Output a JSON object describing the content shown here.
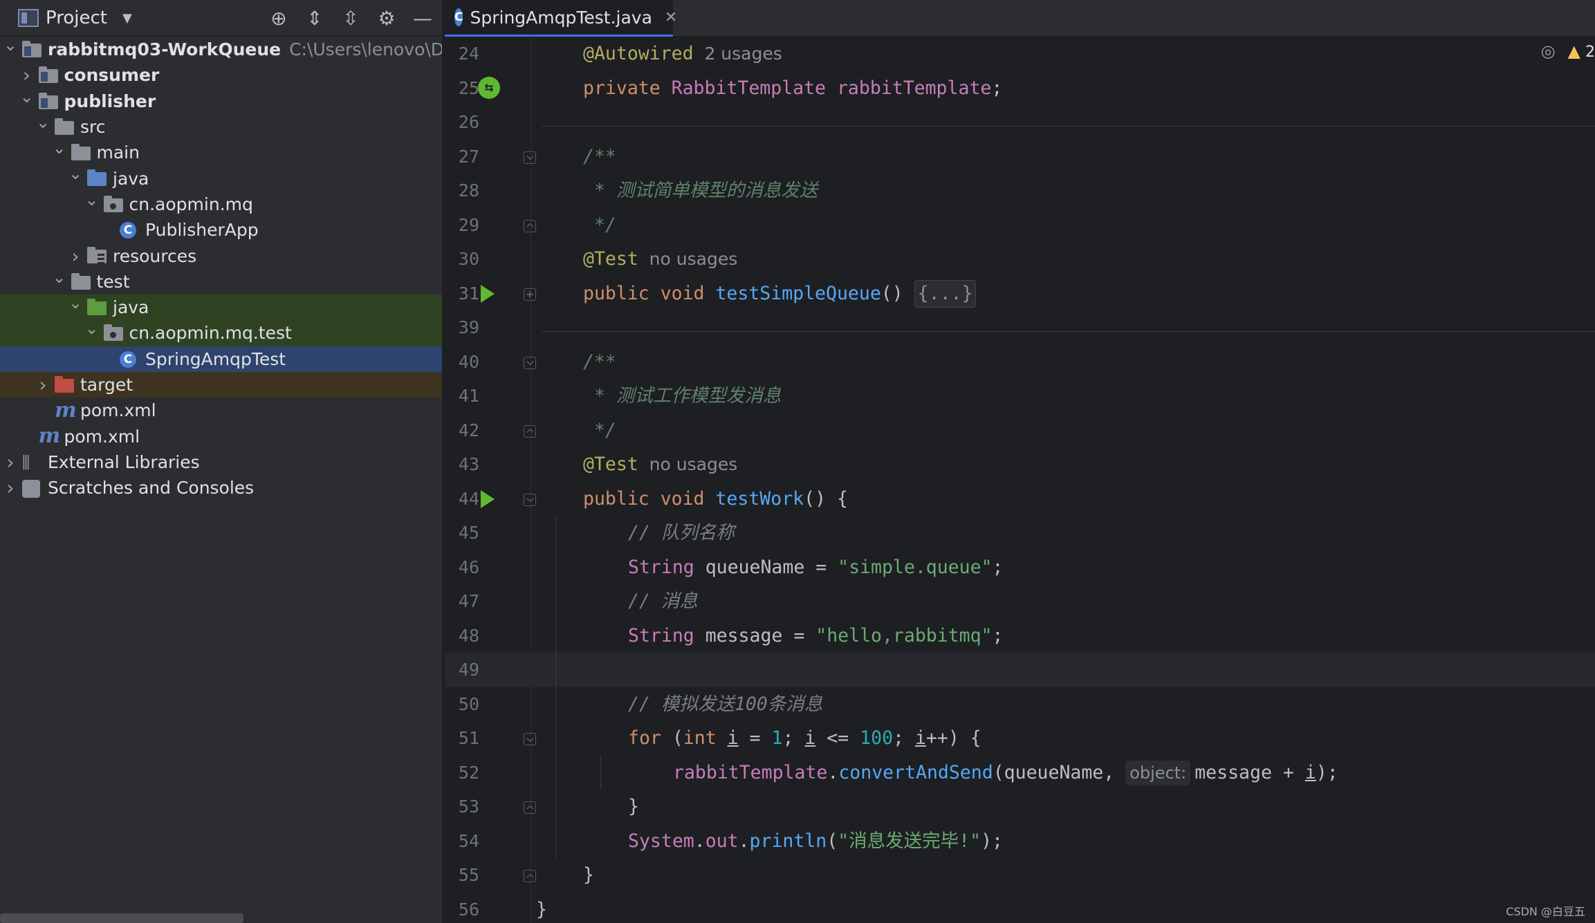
{
  "project_panel": {
    "title": "Project",
    "tools": [
      "locate-icon",
      "expand-all-icon",
      "collapse-all-icon",
      "settings-icon",
      "hide-icon"
    ]
  },
  "tree": [
    {
      "label": "rabbitmq03-WorkQueue",
      "hint": "C:\\Users\\lenovo\\Desk",
      "depth": 0,
      "expanded": true,
      "icon": "module-folder",
      "bold": true
    },
    {
      "label": "consumer",
      "depth": 1,
      "expanded": false,
      "icon": "module-folder",
      "bold": true
    },
    {
      "label": "publisher",
      "depth": 1,
      "expanded": true,
      "icon": "module-folder",
      "bold": true
    },
    {
      "label": "src",
      "depth": 2,
      "expanded": true,
      "icon": "folder"
    },
    {
      "label": "main",
      "depth": 3,
      "expanded": true,
      "icon": "folder"
    },
    {
      "label": "java",
      "depth": 4,
      "expanded": true,
      "icon": "source-folder"
    },
    {
      "label": "cn.aopmin.mq",
      "depth": 5,
      "expanded": true,
      "icon": "package"
    },
    {
      "label": "PublisherApp",
      "depth": 6,
      "icon": "class"
    },
    {
      "label": "resources",
      "depth": 4,
      "expanded": false,
      "icon": "resources-folder"
    },
    {
      "label": "test",
      "depth": 3,
      "expanded": true,
      "icon": "folder"
    },
    {
      "label": "java",
      "depth": 4,
      "expanded": true,
      "icon": "test-folder",
      "highlight": "green"
    },
    {
      "label": "cn.aopmin.mq.test",
      "depth": 5,
      "expanded": true,
      "icon": "package",
      "highlight": "green"
    },
    {
      "label": "SpringAmqpTest",
      "depth": 6,
      "icon": "class",
      "highlight": "selected"
    },
    {
      "label": "target",
      "depth": 2,
      "expanded": false,
      "icon": "excluded-folder",
      "highlight": "excluded"
    },
    {
      "label": "pom.xml",
      "depth": 2,
      "icon": "maven"
    },
    {
      "label": "pom.xml",
      "depth": 1,
      "icon": "maven"
    },
    {
      "label": "External Libraries",
      "depth": 0,
      "expanded": false,
      "icon": "libraries"
    },
    {
      "label": "Scratches and Consoles",
      "depth": 0,
      "expanded": false,
      "icon": "scratches"
    }
  ],
  "editor": {
    "tab": {
      "label": "SpringAmqpTest.java",
      "icon_letter": "C"
    },
    "status": {
      "warnings": "2"
    },
    "lines": [
      {
        "n": "24",
        "indent": 1,
        "tokens": [
          [
            "ann",
            "@Autowired"
          ],
          [
            "hint",
            "  2 usages"
          ]
        ]
      },
      {
        "n": "25",
        "indent": 1,
        "gutter": "bean",
        "tokens": [
          [
            "kw",
            "private "
          ],
          [
            "type",
            "RabbitTemplate "
          ],
          [
            "fieldname",
            "rabbitTemplate"
          ],
          [
            "brk",
            ";"
          ]
        ]
      },
      {
        "n": "26",
        "indent": 0,
        "tokens": []
      },
      {
        "n": "27",
        "indent": 1,
        "fold": "down",
        "tokens": [
          [
            "doc",
            "/**"
          ]
        ]
      },
      {
        "n": "28",
        "indent": 1,
        "tokens": [
          [
            "doc",
            " * 测试简单模型的消息发送"
          ]
        ]
      },
      {
        "n": "29",
        "indent": 1,
        "fold": "up",
        "tokens": [
          [
            "doc",
            " */"
          ]
        ]
      },
      {
        "n": "30",
        "indent": 1,
        "tokens": [
          [
            "ann",
            "@Test"
          ],
          [
            "hint",
            "  no usages"
          ]
        ]
      },
      {
        "n": "31",
        "indent": 1,
        "gutter": "run",
        "fold": "plus",
        "tokens": [
          [
            "kw",
            "public "
          ],
          [
            "kw",
            "void "
          ],
          [
            "fn",
            "testSimpleQueue"
          ],
          [
            "brk",
            "() "
          ],
          [
            "pill",
            "{...}"
          ]
        ]
      },
      {
        "n": "39",
        "indent": 0,
        "tokens": []
      },
      {
        "n": "40",
        "indent": 1,
        "fold": "down",
        "tokens": [
          [
            "doc",
            "/**"
          ]
        ]
      },
      {
        "n": "41",
        "indent": 1,
        "tokens": [
          [
            "doc",
            " * 测试工作模型发消息"
          ]
        ]
      },
      {
        "n": "42",
        "indent": 1,
        "fold": "up",
        "tokens": [
          [
            "doc",
            " */"
          ]
        ]
      },
      {
        "n": "43",
        "indent": 1,
        "tokens": [
          [
            "ann",
            "@Test"
          ],
          [
            "hint",
            "  no usages"
          ]
        ]
      },
      {
        "n": "44",
        "indent": 1,
        "gutter": "run",
        "fold": "down",
        "tokens": [
          [
            "kw",
            "public "
          ],
          [
            "kw",
            "void "
          ],
          [
            "fn",
            "testWork"
          ],
          [
            "brk",
            "() {"
          ]
        ]
      },
      {
        "n": "45",
        "indent": 2,
        "tokens": [
          [
            "cmt",
            "// 队列名称"
          ]
        ]
      },
      {
        "n": "46",
        "indent": 2,
        "tokens": [
          [
            "type",
            "String "
          ],
          [
            "brk",
            "queueName = "
          ],
          [
            "str",
            "\"simple.queue\""
          ],
          [
            "brk",
            ";"
          ]
        ]
      },
      {
        "n": "47",
        "indent": 2,
        "tokens": [
          [
            "cmt",
            "// 消息"
          ]
        ]
      },
      {
        "n": "48",
        "indent": 2,
        "tokens": [
          [
            "type",
            "String "
          ],
          [
            "brk",
            "message = "
          ],
          [
            "str",
            "\"hello,rabbitmq\""
          ],
          [
            "brk",
            ";"
          ]
        ]
      },
      {
        "n": "49",
        "indent": 0,
        "current": true,
        "tokens": []
      },
      {
        "n": "50",
        "indent": 2,
        "tokens": [
          [
            "cmt",
            "// 模拟发送100条消息"
          ]
        ]
      },
      {
        "n": "51",
        "indent": 2,
        "fold": "down",
        "tokens": [
          [
            "kw",
            "for "
          ],
          [
            "brk",
            "("
          ],
          [
            "kw",
            "int "
          ],
          [
            "ulbrk",
            "i"
          ],
          [
            "brk",
            " = "
          ],
          [
            "num",
            "1"
          ],
          [
            "brk",
            "; "
          ],
          [
            "ulbrk",
            "i"
          ],
          [
            "brk",
            " <= "
          ],
          [
            "num",
            "100"
          ],
          [
            "brk",
            "; "
          ],
          [
            "ulbrk",
            "i"
          ],
          [
            "brk",
            "++) {"
          ]
        ]
      },
      {
        "n": "52",
        "indent": 3,
        "tokens": [
          [
            "fieldname",
            "rabbitTemplate"
          ],
          [
            "brk",
            "."
          ],
          [
            "fn",
            "convertAndSend"
          ],
          [
            "brk",
            "(queueName, "
          ],
          [
            "inlay",
            "object:"
          ],
          [
            "brk",
            "message + "
          ],
          [
            "ulbrk",
            "i"
          ],
          [
            "brk",
            ");"
          ]
        ]
      },
      {
        "n": "53",
        "indent": 2,
        "fold": "up",
        "tokens": [
          [
            "brk",
            "}"
          ]
        ]
      },
      {
        "n": "54",
        "indent": 2,
        "tokens": [
          [
            "type",
            "System"
          ],
          [
            "brk",
            "."
          ],
          [
            "fieldname",
            "out"
          ],
          [
            "brk",
            "."
          ],
          [
            "fn",
            "println"
          ],
          [
            "brk",
            "("
          ],
          [
            "str",
            "\"消息发送完毕!\""
          ],
          [
            "brk",
            ");"
          ]
        ]
      },
      {
        "n": "55",
        "indent": 1,
        "fold": "up",
        "tokens": [
          [
            "brk",
            "}"
          ]
        ]
      },
      {
        "n": "56",
        "indent": 0,
        "tokens": [
          [
            "brk",
            "}"
          ]
        ]
      }
    ]
  },
  "watermark": "CSDN @白豆五",
  "colors": {
    "run": "#5fb832",
    "selection": "#2e436e",
    "test_highlight": "#2f4322",
    "excluded_highlight": "#3d3320",
    "accent": "#3574f0"
  }
}
